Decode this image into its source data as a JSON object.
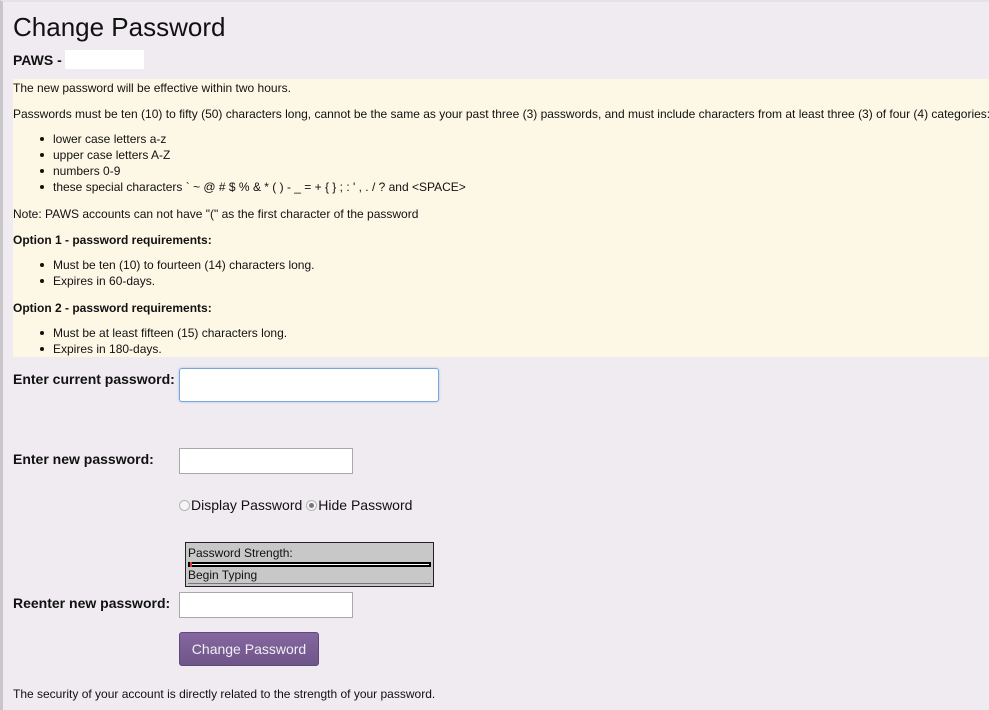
{
  "page": {
    "title": "Change Password",
    "account_label": "PAWS -",
    "account_value_redacted": true
  },
  "info": {
    "effective_note": "The new password will be effective within two hours.",
    "rules_intro": "Passwords must be ten (10) to fifty (50) characters long, cannot be the same as your past three (3) passwords, and must include characters from at least three (3) of four (4) categories:",
    "categories": [
      "lower case letters a-z",
      "upper case letters A-Z",
      "numbers 0-9",
      "these special characters ` ~ @ # $ % & * ( ) - _ = + { } ; : ' , . / ? and <SPACE>"
    ],
    "note": "Note: PAWS accounts can not have \"(\" as the first character of the password",
    "option1": {
      "heading": "Option 1 - password requirements:",
      "items": [
        "Must be ten (10) to fourteen (14) characters long.",
        "Expires in 60-days."
      ]
    },
    "option2": {
      "heading": "Option 2 - password requirements:",
      "items": [
        "Must be at least fifteen (15) characters long.",
        "Expires in 180-days."
      ]
    }
  },
  "form": {
    "current_password_label": "Enter current password:",
    "current_password_value": "",
    "new_password_label": "Enter new password:",
    "new_password_value": "",
    "display_option": {
      "display_label": "Display Password",
      "hide_label": "Hide Password",
      "selected": "hide"
    },
    "strength": {
      "title": "Password Strength:",
      "status": "Begin Typing",
      "level_percent": 1,
      "fill_color": "#e23b2e"
    },
    "reenter_password_label": "Reenter new password:",
    "reenter_password_value": "",
    "submit_label": "Change Password"
  },
  "footer": {
    "text": "The security of your account is directly related to the strength of your password."
  },
  "colors": {
    "background": "#efebf0",
    "info_background": "#fdf7e6",
    "button": "#7a5f95"
  }
}
